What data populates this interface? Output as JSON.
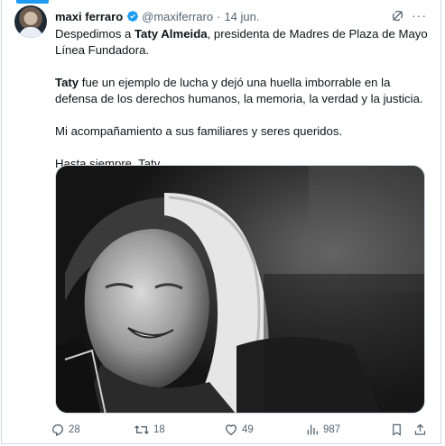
{
  "post": {
    "author_name": "maxi ferraro",
    "handle": "@maxiferraro",
    "separator": "·",
    "date": "14 jun.",
    "more_label": "···",
    "body": {
      "p1_pre": "Despedimos a ",
      "p1_bold": "Taty Almeida",
      "p1_post": ", presidenta de Madres de Plaza de Mayo Línea Fundadora.",
      "p2_bold": "Taty",
      "p2_post": " fue un ejemplo de lucha y dejó una huella imborrable en la defensa de los derechos humanos, la memoria, la verdad y la justicia.",
      "p3": "Mi acompañamiento a sus familiares y seres queridos.",
      "p4": "Hasta siempre, Taty."
    },
    "media": {
      "type": "photo",
      "style": "black-and-white"
    }
  },
  "actions": {
    "replies": "28",
    "reposts": "18",
    "likes": "49",
    "views": "987"
  },
  "icons": {
    "verified": "verified-badge-icon",
    "grok": "grok-icon",
    "more": "more-icon",
    "reply": "reply-icon",
    "repost": "repost-icon",
    "like": "heart-icon",
    "views": "views-icon",
    "bookmark": "bookmark-icon",
    "share": "share-icon"
  },
  "colors": {
    "accent": "#1d9bf0",
    "text": "#0f1419",
    "secondary": "#536471",
    "border": "#cfd9de"
  }
}
